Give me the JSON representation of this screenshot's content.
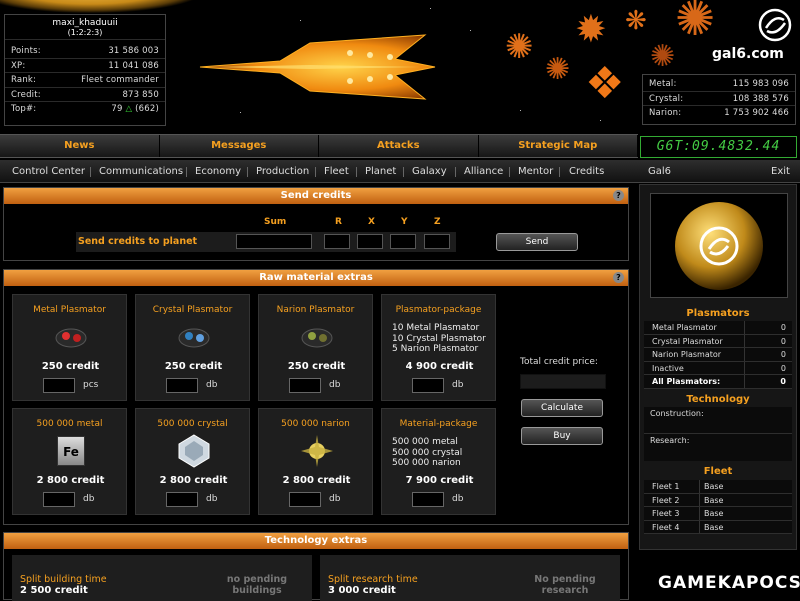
{
  "player": {
    "name": "maxi_khaduuii",
    "coords": "(1:2:2:3)",
    "stats": [
      {
        "label": "Points:",
        "value": "31 586 003"
      },
      {
        "label": "XP:",
        "value": "11 041 086"
      },
      {
        "label": "Rank:",
        "value": "Fleet commander"
      },
      {
        "label": "Credit:",
        "value": "873 850"
      }
    ],
    "top_label": "Top#:",
    "top_value": "79",
    "top_change": "(662)"
  },
  "brand": {
    "logo_text": "gal6.com"
  },
  "resources": [
    {
      "label": "Metal:",
      "value": "115 983 096"
    },
    {
      "label": "Crystal:",
      "value": "108 388 576"
    },
    {
      "label": "Narion:",
      "value": "1 753 902 466"
    }
  ],
  "nav_main": [
    "News",
    "Messages",
    "Attacks",
    "Strategic Map"
  ],
  "clock": "G6T:09.4832.44",
  "nav_sub": [
    "Control Center",
    "Communications",
    "Economy",
    "Production",
    "Fleet",
    "Planet",
    "Galaxy",
    "Alliance",
    "Mentor",
    "Credits"
  ],
  "nav_right": {
    "left": "Gal6",
    "right": "Exit"
  },
  "send_credits": {
    "title": "Send credits",
    "row_label": "Send credits to planet",
    "col_sum": "Sum",
    "col_r": "R",
    "col_x": "X",
    "col_y": "Y",
    "col_z": "Z",
    "send_button": "Send",
    "help": "?"
  },
  "raw_material": {
    "title": "Raw material extras",
    "help": "?",
    "cards": [
      {
        "title": "Metal Plasmator",
        "price": "250 credit",
        "unit": "pcs"
      },
      {
        "title": "Crystal Plasmator",
        "price": "250 credit",
        "unit": "db"
      },
      {
        "title": "Narion Plasmator",
        "price": "250 credit",
        "unit": "db"
      },
      {
        "title": "Plasmator-package",
        "lines": [
          "10 Metal Plasmator",
          "10 Crystal Plasmator",
          "5 Narion Plasmator"
        ],
        "price": "4 900 credit",
        "unit": "db"
      },
      {
        "title": "500 000 metal",
        "price": "2 800 credit",
        "unit": "db",
        "icon_text": "Fe"
      },
      {
        "title": "500 000 crystal",
        "price": "2 800 credit",
        "unit": "db"
      },
      {
        "title": "500 000 narion",
        "price": "2 800 credit",
        "unit": "db"
      },
      {
        "title": "Material-package",
        "lines": [
          "500 000 metal",
          "500 000 crystal",
          "500 000 narion"
        ],
        "price": "7 900 credit",
        "unit": "db"
      }
    ],
    "total_label": "Total credit price:",
    "calculate_button": "Calculate",
    "buy_button": "Buy"
  },
  "tech_extras": {
    "title": "Technology extras",
    "building_label": "Split building time",
    "building_price": "2 500 credit",
    "building_status": [
      "no pending",
      "buildings"
    ],
    "research_label": "Split research time",
    "research_price": "3 000 credit",
    "research_status": [
      "No pending",
      "research"
    ]
  },
  "sidebar": {
    "plasmators_title": "Plasmators",
    "plasmators": [
      {
        "label": "Metal Plasmator",
        "value": "0"
      },
      {
        "label": "Crystal Plasmator",
        "value": "0"
      },
      {
        "label": "Narion Plasmator",
        "value": "0"
      },
      {
        "label": "Inactive",
        "value": "0"
      },
      {
        "label": "All Plasmators:",
        "value": "0"
      }
    ],
    "technology_title": "Technology",
    "construction_label": "Construction:",
    "research_label": "Research:",
    "fleet_title": "Fleet",
    "fleets": [
      {
        "name": "Fleet 1",
        "location": "Base"
      },
      {
        "name": "Fleet 2",
        "location": "Base"
      },
      {
        "name": "Fleet 3",
        "location": "Base"
      },
      {
        "name": "Fleet 4",
        "location": "Base"
      }
    ]
  },
  "watermark": "GAMEKAPOCS",
  "colors": {
    "accent": "#f5a020",
    "header_bar": "#d9741c",
    "clock_green": "#44cc44",
    "trend_up": "#33cc33"
  }
}
